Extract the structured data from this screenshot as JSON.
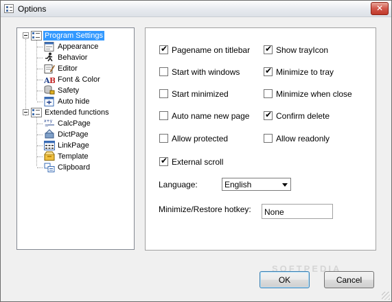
{
  "window": {
    "title": "Options",
    "close_symbol": "✕"
  },
  "tree": {
    "groups": [
      {
        "label": "Program Settings",
        "selected": true,
        "icon": "settings-list-icon",
        "children": [
          {
            "label": "Appearance",
            "icon": "appearance-icon"
          },
          {
            "label": "Behavior",
            "icon": "behavior-icon"
          },
          {
            "label": "Editor",
            "icon": "editor-icon"
          },
          {
            "label": "Font & Color",
            "icon": "font-color-icon"
          },
          {
            "label": "Safety",
            "icon": "safety-icon"
          },
          {
            "label": "Auto hide",
            "icon": "auto-hide-icon"
          }
        ]
      },
      {
        "label": "Extended functions",
        "selected": false,
        "icon": "extended-list-icon",
        "children": [
          {
            "label": "CalcPage",
            "icon": "calc-icon"
          },
          {
            "label": "DictPage",
            "icon": "dict-icon"
          },
          {
            "label": "LinkPage",
            "icon": "link-icon"
          },
          {
            "label": "Template",
            "icon": "template-icon"
          },
          {
            "label": "Clipboard",
            "icon": "clipboard-icon"
          }
        ]
      }
    ]
  },
  "options": {
    "pagename_on_titlebar": {
      "label": "Pagename on titlebar",
      "checked": true
    },
    "show_trayicon": {
      "label": "Show trayIcon",
      "checked": true
    },
    "start_with_windows": {
      "label": "Start with windows",
      "checked": false
    },
    "minimize_to_tray": {
      "label": "Minimize to tray",
      "checked": true
    },
    "start_minimized": {
      "label": "Start minimized",
      "checked": false
    },
    "minimize_when_close": {
      "label": "Minimize when close",
      "checked": false
    },
    "auto_name_new_page": {
      "label": "Auto name new page",
      "checked": false
    },
    "confirm_delete": {
      "label": "Confirm delete",
      "checked": true
    },
    "allow_protected": {
      "label": "Allow protected",
      "checked": false
    },
    "allow_readonly": {
      "label": "Allow readonly",
      "checked": false
    },
    "external_scroll": {
      "label": "External scroll",
      "checked": true
    }
  },
  "language": {
    "label": "Language:",
    "value": "English"
  },
  "hotkey": {
    "label": "Minimize/Restore hotkey:",
    "value": "None"
  },
  "buttons": {
    "ok": "OK",
    "cancel": "Cancel"
  },
  "watermark": "SOFTPEDIA",
  "colors": {
    "selection": "#3399ff",
    "close_button": "#c94636",
    "default_button_border": "#3c7fb1"
  }
}
